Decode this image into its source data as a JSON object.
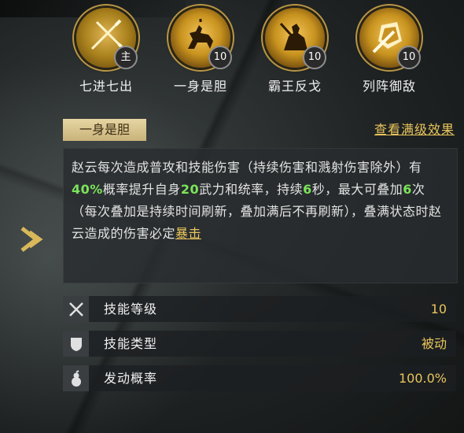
{
  "banner": {
    "text": ""
  },
  "skills": [
    {
      "name": "七进七出",
      "badge": "主",
      "icon": "crossed-spears-icon"
    },
    {
      "name": "一身是胆",
      "badge": "10",
      "icon": "horse-rider-icon"
    },
    {
      "name": "霸王反戈",
      "badge": "10",
      "icon": "warrior-icon"
    },
    {
      "name": "列阵御敌",
      "badge": "10",
      "icon": "shield-formation-icon"
    }
  ],
  "detail": {
    "title": "一身是胆",
    "view_full_label": "查看满级效果",
    "desc_1": "赵云每次造成普攻和技能伤害（持续伤害和溅射伤害除外）有",
    "pct": "40%",
    "desc_2": "概率提升自身",
    "amt": "20",
    "desc_3": "武力和统率，持续",
    "dur": "6",
    "desc_4": "秒，最大可叠加",
    "stack": "6",
    "desc_5": "次（每次叠加是持续时间刷新，叠加满后不再刷新），叠满状态时赵云造成的伤害必定",
    "crit_link": "暴击"
  },
  "stats": [
    {
      "label": "技能等级",
      "value": "10",
      "icon": "crossed-swords-icon"
    },
    {
      "label": "技能类型",
      "value": "被动",
      "icon": "shield-icon"
    },
    {
      "label": "发动概率",
      "value": "100.0%",
      "icon": "gourd-icon"
    }
  ],
  "colors": {
    "accent": "#e8c55c",
    "highlight": "#7be35a",
    "tag_bg": "#d9c58e"
  }
}
